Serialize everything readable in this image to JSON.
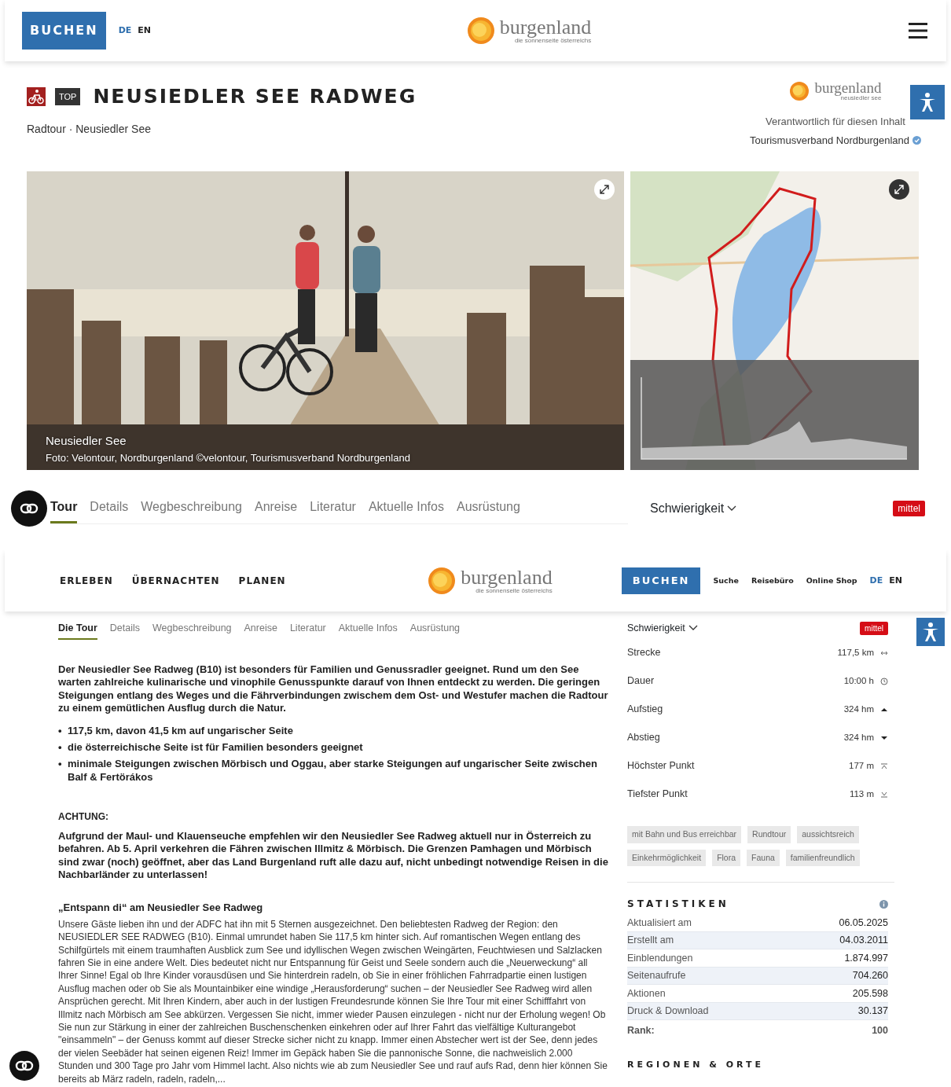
{
  "top_view": {
    "header": {
      "book_button": "BUCHEN",
      "languages": [
        {
          "label": "DE",
          "selected": true
        },
        {
          "label": "EN",
          "selected": false
        }
      ],
      "logo": {
        "name": "burgenland",
        "tagline": "die sonnenseite österreichs"
      }
    },
    "title": {
      "badge": "TOP",
      "heading": "NEUSIEDLER SEE RADWEG",
      "subtitle": "Radtour · Neusiedler See"
    },
    "publisher": {
      "logo_name": "burgenland",
      "logo_tagline": "neusiedler see",
      "label": "Verantwortlich für diesen Inhalt",
      "name": "Tourismusverband Nordburgenland"
    },
    "photo": {
      "kind": "picture",
      "caption": "Neusiedler See",
      "credit": "Foto: Velontour, Nordburgenland ©velontour, Tourismusverband Nordburgenland"
    },
    "tabs": [
      {
        "label": "Tour",
        "selected": true
      },
      {
        "label": "Details",
        "selected": false
      },
      {
        "label": "Wegbeschreibung",
        "selected": false
      },
      {
        "label": "Anreise",
        "selected": false
      },
      {
        "label": "Literatur",
        "selected": false
      },
      {
        "label": "Aktuelle Infos",
        "selected": false
      },
      {
        "label": "Ausrüstung",
        "selected": false
      }
    ],
    "difficulty": {
      "label": "Schwierigkeit",
      "value": "mittel"
    }
  },
  "bottom_view": {
    "nav": [
      "ERLEBEN",
      "ÜBERNACHTEN",
      "PLANEN"
    ],
    "logo": {
      "name": "burgenland",
      "tagline": "die sonnenseite österreichs"
    },
    "book_button": "BUCHEN",
    "links": [
      "Suche",
      "Reisebüro",
      "Online Shop"
    ],
    "languages": [
      {
        "label": "DE",
        "selected": true
      },
      {
        "label": "EN",
        "selected": false
      }
    ],
    "tabs": [
      {
        "label": "Die Tour",
        "selected": true
      },
      {
        "label": "Details",
        "selected": false
      },
      {
        "label": "Wegbeschreibung",
        "selected": false
      },
      {
        "label": "Anreise",
        "selected": false
      },
      {
        "label": "Literatur",
        "selected": false
      },
      {
        "label": "Aktuelle Infos",
        "selected": false
      },
      {
        "label": "Ausrüstung",
        "selected": false
      }
    ],
    "intro": "Der Neusiedler See Radweg (B10) ist besonders für Familien und Genussradler geeignet. Rund um den See warten zahlreiche kulinarische und vinophile Genusspunkte darauf von Ihnen entdeckt zu werden. Die geringen Steigungen entlang des Weges und die Fährverbindungen zwischem dem Ost- und Westufer  machen die Radtour zu einem gemütlichen Ausflug durch die Natur.",
    "bullets": [
      {
        "marker": "•",
        "text": "117,5  km, davon 41,5 km auf ungarischer Seite"
      },
      {
        "marker": "•",
        "text": "die österreichische Seite ist für Familien besonders geeignet"
      },
      {
        "marker": "•",
        "text": "minimale Steigungen zwischen Mörbisch und Oggau, aber starke Steigungen auf ungarischer Seite zwischen Balf & Fertörákos"
      }
    ],
    "warning_title": "ACHTUNG:",
    "warning": "Aufgrund der Maul- und Klauenseuche empfehlen wir den Neusiedler See Radweg aktuell nur in Österreich zu befahren. Ab 5. April verkehren die Fähren zwischen Illmitz & Mörbisch. Die Grenzen Pamhagen und Mörbisch sind zwar (noch) geöffnet, aber das Land Burgenland ruft alle dazu auf, nicht unbedingt notwendige Reisen in die Nachbarländer zu unterlassen!",
    "section_title": "„Entspann di“ am Neusiedler See Radweg",
    "body": "Unsere Gäste lieben ihn und der ADFC hat ihn mit 5 Sternen ausgezeichnet. Den beliebtesten Radweg der Region: den NEUSIEDLER SEE RADWEG (B10). Einmal umrundet haben Sie 117,5 km hinter sich. Auf romantischen Wegen entlang des Schilfgürtels mit einem traumhaften Ausblick zum See und idyllischen Wegen zwischen Weingärten, Feuchtwiesen und Salzlacken fahren Sie in eine andere Welt. Dies bedeutet nicht nur Entspannung für Geist und Seele sondern auch die „Neuerweckung“ all Ihrer Sinne! Egal ob Ihre Kinder vorausdüsen und Sie hinterdrein radeln, ob Sie in einer fröhlichen Fahrradpartie einen lustigen Ausflug machen oder ob Sie als Mountainbiker eine windige „Herausforderung“ suchen – der Neusiedler See Radweg wird allen Ansprüchen gerecht. Mit Ihren Kindern, aber auch in der lustigen Freundesrunde können Sie Ihre Tour mit einer Schifffahrt von Illmitz nach Mörbisch am See abkürzen. Vergessen Sie nicht, immer wieder Pausen einzulegen - nicht nur der Erholung wegen! Ob Sie nun zur Stärkung in einer der zahlreichen Buschenschenken einkehren oder auf Ihrer Fahrt das vielfältige Kulturangebot \"einsammeln\" – der Genuss kommt auf dieser Strecke sicher nicht zu knapp. Immer einen Abstecher wert ist der See, denn jedes der vielen Seebäder hat seinen eigenen Reiz! Immer im Gepäck haben Sie die pannonische Sonne, die nachweislich 2.000 Stunden und 300 Tage pro Jahr vom Himmel lacht. Also nichts wie ab zum Neusiedler See und rauf aufs Rad, denn hier können Sie bereits ab März radeln, radeln, radeln,...",
    "difficulty": {
      "label": "Schwierigkeit",
      "value": "mittel"
    },
    "facts": [
      {
        "label": "Strecke",
        "value": "117,5 km",
        "kind": "distance"
      },
      {
        "label": "Dauer",
        "value": "10:00 h",
        "kind": "duration"
      },
      {
        "label": "Aufstieg",
        "value": "324 hm",
        "kind": "ascent"
      },
      {
        "label": "Abstieg",
        "value": "324 hm",
        "kind": "descent"
      },
      {
        "label": "Höchster Punkt",
        "value": "177 m",
        "kind": "highest"
      },
      {
        "label": "Tiefster Punkt",
        "value": "113 m",
        "kind": "lowest"
      }
    ],
    "tags": [
      "mit Bahn und Bus erreichbar",
      "Rundtour",
      "aussichtsreich",
      "Einkehrmöglichkeit",
      "Flora",
      "Fauna",
      "familienfreundlich"
    ],
    "statistics": {
      "title": "STATISTIKEN",
      "rows": [
        {
          "label": "Aktualisiert am",
          "value": "06.05.2025"
        },
        {
          "label": "Erstellt am",
          "value": "04.03.2011"
        },
        {
          "label": "Einblendungen",
          "value": "1.874.997"
        },
        {
          "label": "Seitenaufrufe",
          "value": "704.260"
        },
        {
          "label": "Aktionen",
          "value": "205.598"
        },
        {
          "label": "Druck & Download",
          "value": "30.137"
        }
      ],
      "rank": {
        "label": "Rank:",
        "value": "100"
      }
    },
    "next_section": "REGIONEN & ORTE"
  }
}
